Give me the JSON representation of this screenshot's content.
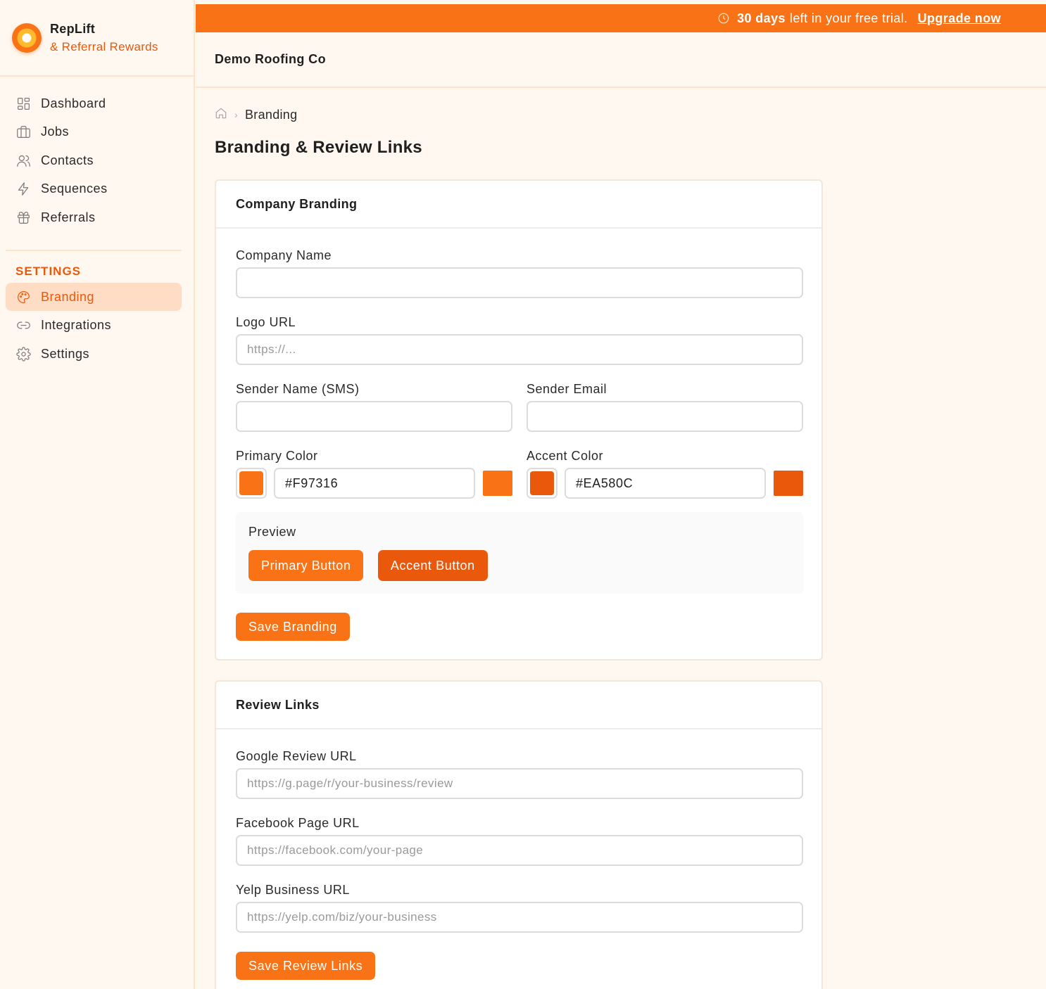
{
  "sidebar": {
    "brand_title": "RepLift",
    "brand_subtitle": "& Referral Rewards",
    "nav": [
      {
        "label": "Dashboard",
        "icon": "dashboard-grid-icon"
      },
      {
        "label": "Jobs",
        "icon": "briefcase-icon"
      },
      {
        "label": "Contacts",
        "icon": "users-icon"
      },
      {
        "label": "Sequences",
        "icon": "lightning-icon"
      },
      {
        "label": "Referrals",
        "icon": "gift-icon"
      }
    ],
    "settings_label": "SETTINGS",
    "settings_nav": [
      {
        "label": "Branding",
        "icon": "palette-icon",
        "active": true
      },
      {
        "label": "Integrations",
        "icon": "link-icon"
      },
      {
        "label": "Settings",
        "icon": "gear-icon"
      }
    ]
  },
  "banner": {
    "days": "30 days",
    "text": "left in your free trial.",
    "link": "Upgrade now",
    "icon": "clock-icon"
  },
  "header": {
    "company": "Demo Roofing Co"
  },
  "breadcrumb": {
    "current": "Branding",
    "home_icon": "home-icon"
  },
  "page_title": "Branding & Review Links",
  "branding_card": {
    "title": "Company Branding",
    "company_name": {
      "label": "Company Name",
      "value": "",
      "placeholder": ""
    },
    "logo_url": {
      "label": "Logo URL",
      "value": "",
      "placeholder": "https://..."
    },
    "sender_name": {
      "label": "Sender Name (SMS)",
      "value": "",
      "placeholder": ""
    },
    "sender_email": {
      "label": "Sender Email",
      "value": "",
      "placeholder": ""
    },
    "primary_color": {
      "label": "Primary Color",
      "value": "#F97316"
    },
    "accent_color": {
      "label": "Accent Color",
      "value": "#EA580C"
    },
    "preview": {
      "label": "Preview",
      "primary_button": "Primary Button",
      "accent_button": "Accent Button"
    },
    "save_label": "Save Branding"
  },
  "review_card": {
    "title": "Review Links",
    "google": {
      "label": "Google Review URL",
      "placeholder": "https://g.page/r/your-business/review"
    },
    "facebook": {
      "label": "Facebook Page URL",
      "placeholder": "https://facebook.com/your-page"
    },
    "yelp": {
      "label": "Yelp Business URL",
      "placeholder": "https://yelp.com/biz/your-business"
    },
    "save_label": "Save Review Links"
  },
  "colors": {
    "brand": "#F97316",
    "accent": "#EA580C",
    "active_bg": "#FEDDC4"
  }
}
